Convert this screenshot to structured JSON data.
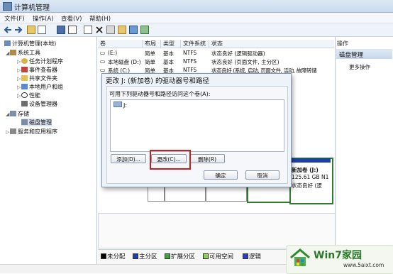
{
  "window": {
    "title": "计算机管理"
  },
  "menu": [
    "文件(F)",
    "操作(A)",
    "查看(V)",
    "帮助(H)"
  ],
  "tree": {
    "root": "计算机管理(本地)",
    "system_tools": "系统工具",
    "task_scheduler": "任务计划程序",
    "event_viewer": "事件查看器",
    "shared_folders": "共享文件夹",
    "local_users": "本地用户和组",
    "performance": "性能",
    "device_manager": "设备管理器",
    "storage": "存储",
    "disk_management": "磁盘管理",
    "services": "服务和应用程序"
  },
  "columns": [
    "卷",
    "布局",
    "类型",
    "文件系统",
    "状态"
  ],
  "volumes": [
    {
      "vol": "(E:)",
      "layout": "简单",
      "type": "基本",
      "fs": "NTFS",
      "status": "状态良好 (逻辑驱动器)"
    },
    {
      "vol": "本地磁盘 (D:)",
      "layout": "简单",
      "type": "基本",
      "fs": "NTFS",
      "status": "状态良好 (页面文件, 主分区)"
    },
    {
      "vol": "系统 (C:)",
      "layout": "简单",
      "type": "基本",
      "fs": "NTFS",
      "status": "状态良好 (系统, 启动, 页面文件, 活动, 故障转储"
    }
  ],
  "actions": {
    "title": "操作",
    "selected": "磁盘管理",
    "more": "更多操作"
  },
  "dialog": {
    "title": "更改 J: (新加卷) 的驱动器号和路径",
    "description": "可用下列驱动器号和路径访问这个卷(A):",
    "item": "J:",
    "add": "添加(D)...",
    "change": "更改(C)...",
    "remove": "删除(R)",
    "ok": "确定",
    "cancel": "取消"
  },
  "disk_j": {
    "name": "新加卷 (J:)",
    "size": "125.61 GB N1",
    "status": "状态良好 (逻"
  },
  "legend": [
    "未分配",
    "主分区",
    "扩展分区",
    "可用空间",
    "逻辑"
  ],
  "legend_colors": [
    "#000000",
    "#1f3fa8",
    "#3fa63f",
    "#8fd14f",
    "#2b3bd0"
  ],
  "watermark": {
    "brand": "Win7家园",
    "url": "www.5aixt.com"
  }
}
